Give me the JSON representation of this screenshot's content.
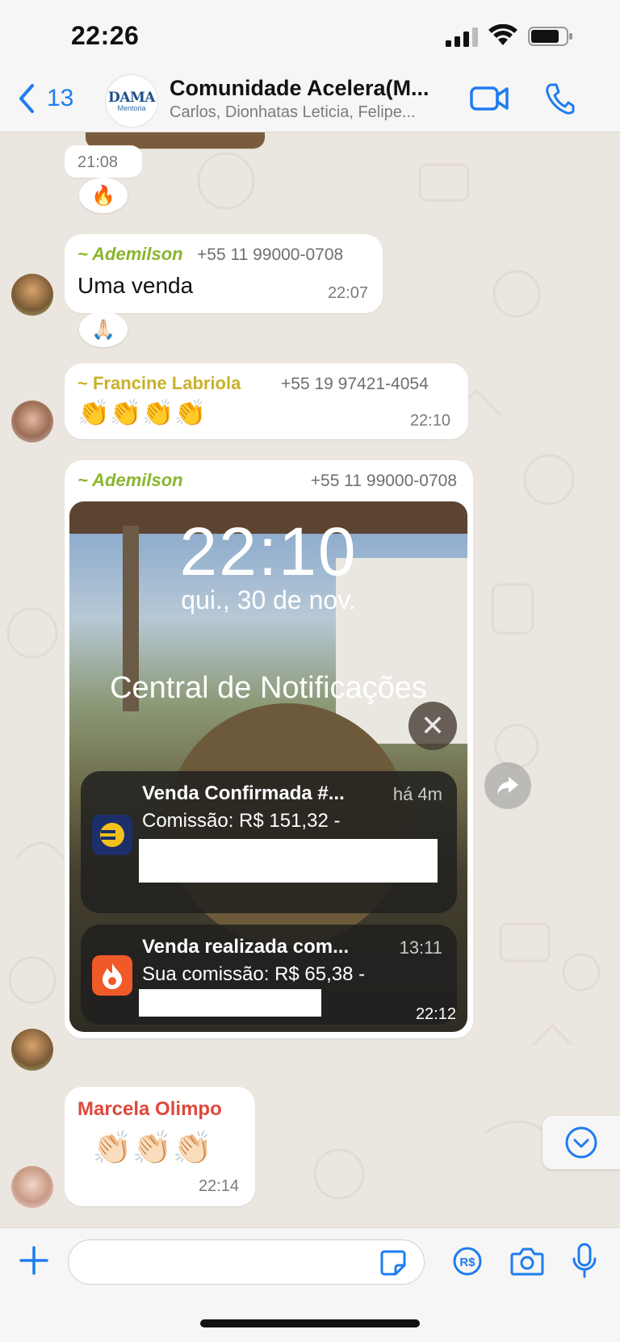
{
  "status_bar": {
    "time": "22:26"
  },
  "header": {
    "back_count": "13",
    "group_avatar_text": "DAMA",
    "group_avatar_sub": "Mentoria",
    "title": "Comunidade Acelera(M...",
    "subtitle": "Carlos, Dionhatas Leticia, Felipe..."
  },
  "messages": {
    "m0": {
      "time": "21:08",
      "reaction": "🔥"
    },
    "m1": {
      "sender": "~ Ademilson",
      "phone": "+55 11 99000-0708",
      "text": "Uma venda",
      "time": "22:07",
      "reaction": "🙏🏻"
    },
    "m2": {
      "sender": "~ Francine Labriola",
      "phone": "+55 19 97421-4054",
      "text": "👏👏👏👏",
      "time": "22:10"
    },
    "m3": {
      "sender": "~ Ademilson",
      "phone": "+55 11 99000-0708",
      "time": "22:12",
      "screenshot": {
        "lock_time": "22:10",
        "lock_date": "qui., 30 de nov.",
        "center_title": "Central de Notificações",
        "notifications": [
          {
            "title": "Venda Confirmada #...",
            "time": "há 4m",
            "body": "Comissão: R$ 151,32 -"
          },
          {
            "title": "Venda realizada com...",
            "time": "13:11",
            "body": "Sua comissão: R$ 65,38 -"
          }
        ]
      }
    },
    "m4": {
      "sender": "Marcela Olimpo",
      "text": "👏🏻👏🏻👏🏻",
      "time": "22:14"
    }
  },
  "input": {
    "placeholder": ""
  },
  "colors": {
    "accent": "#1f7cf0",
    "sender_green": "#8ab52e",
    "sender_yellow": "#c9b02a",
    "sender_red": "#e0473a",
    "chat_bg": "#ebe6df"
  }
}
